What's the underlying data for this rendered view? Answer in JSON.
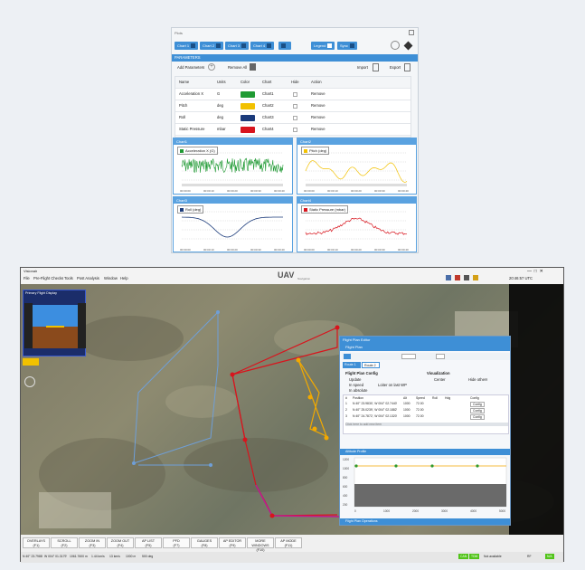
{
  "plot_window": {
    "title": "Plots",
    "chips": [
      "Chart 1",
      "Chart 2",
      "Chart 3",
      "Chart 4"
    ],
    "legend_label": "Legend",
    "sync_label": "Sync",
    "params_title": "PARAMETERS",
    "add_label": "Add Parameters",
    "remove_all_label": "Remove All",
    "import_label": "Import",
    "export_label": "Export",
    "columns": [
      "Name",
      "Units",
      "Color",
      "Chart",
      "Hide",
      "Action"
    ],
    "rows": [
      {
        "name": "Acceleration X",
        "units": "G",
        "color": "#1f9a33",
        "chart": "Chart1",
        "action": "Remove"
      },
      {
        "name": "Pitch",
        "units": "deg",
        "color": "#f2c100",
        "chart": "Chart2",
        "action": "Remove"
      },
      {
        "name": "Roll",
        "units": "deg",
        "color": "#1a3a7a",
        "chart": "Chart3",
        "action": "Remove"
      },
      {
        "name": "Static Pressure",
        "units": "mbar",
        "color": "#d8141d",
        "chart": "Chart4",
        "action": "Remove"
      }
    ],
    "charts": [
      {
        "title": "Chart1",
        "legend": "Acceleration X (G)",
        "color": "#1f9a33"
      },
      {
        "title": "Chart2",
        "legend": "Pitch (deg)",
        "color": "#f2c100"
      },
      {
        "title": "Chart3",
        "legend": "Roll (deg)",
        "color": "#1a3a7a"
      },
      {
        "title": "Chart4",
        "legend": "Static Pressure (mbar)",
        "color": "#d8141d"
      }
    ],
    "xticks": [
      "00:00:00",
      "00:00:10",
      "00:00:20",
      "00:00:30",
      "00:00:40"
    ]
  },
  "app": {
    "title": "Visionair",
    "menu": [
      "File",
      "Pre-Flight Checks",
      "Tools",
      "Post Analysis",
      "Window",
      "Help"
    ],
    "logo_text": "UAV",
    "logo_sub": "Navigation",
    "status_text": "20:46:57 UTC",
    "pfd_title": "Primary Flight Display",
    "flight_plan": {
      "title": "Flight Plan Editor",
      "section": "Flight Plan",
      "tabs": [
        "Route 1",
        "Route 2"
      ],
      "config_title": "Flight Plan Config",
      "viz_title": "Visualization",
      "opts": [
        "Update",
        "In speed",
        "Loiter on last WP",
        "In absolute"
      ],
      "viz_opts": [
        "Center",
        "Hide others"
      ],
      "columns": [
        "#",
        "Position",
        "Alt",
        "Speed",
        "Roll",
        "Hdg",
        "Config"
      ],
      "rows": [
        {
          "n": "1",
          "pos": "N 40° 23.9830', W 004° 02.7440'",
          "alt": "1000",
          "speed": "72.00",
          "cfg": "Config"
        },
        {
          "n": "2",
          "pos": "N 40° 25.0239', W 004° 02.1882'",
          "alt": "1000",
          "speed": "72.00",
          "cfg": "Config"
        },
        {
          "n": "3",
          "pos": "N 40° 24.7872', W 004° 02.1320'",
          "alt": "1000",
          "speed": "72.00",
          "cfg": "Config"
        }
      ],
      "hint": "Click here to add new item",
      "profile_title": "Altitude Profile",
      "ops_title": "Flight Plan Operations",
      "profile_yticks": [
        "1200",
        "1000",
        "800",
        "600",
        "400",
        "200"
      ],
      "profile_xticks": [
        "0",
        "1000",
        "2000",
        "3000",
        "4000",
        "5000"
      ]
    },
    "bottom_buttons": [
      {
        "label": "OVERLAYS",
        "key": "(F1)"
      },
      {
        "label": "SCROLL",
        "key": "(F2)"
      },
      {
        "label": "ZOOM IN",
        "key": "(F3)"
      },
      {
        "label": "ZOOM OUT",
        "key": "(F4)"
      },
      {
        "label": "AP LIST",
        "key": "(F5)"
      },
      {
        "label": "PFD",
        "key": "(F7)"
      },
      {
        "label": "GAUGES",
        "key": "(F8)"
      },
      {
        "label": "AP EDITOR",
        "key": "(F9)"
      },
      {
        "label": "MORE WINDOWS",
        "key": "(F10)"
      },
      {
        "label": "AP MODE",
        "key": "(F11)"
      }
    ],
    "status_bar": [
      "N 40° 23.7988'",
      "W 004° 01.3179'",
      "1061.7600 m",
      "1.44 km/s",
      "13 km/s",
      "1000 m",
      "500 deg"
    ],
    "status_right": [
      "CAN",
      "TDM",
      "Not available",
      "RF",
      "N/A"
    ]
  }
}
